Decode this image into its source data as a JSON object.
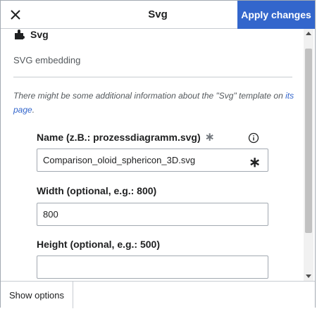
{
  "header": {
    "close_icon": "close-icon",
    "title": "Svg",
    "apply_label": "Apply changes"
  },
  "template": {
    "icon": "puzzle-icon",
    "title": "Svg",
    "description": "SVG embedding",
    "info_text": "There might be some additional information about the \"Svg\" template on ",
    "info_link": "its page",
    "info_end": "."
  },
  "params": [
    {
      "label": "Name (z.B.: prozessdiagramm.svg)",
      "required_mark": "∗",
      "value": "Comparison_oloid_sphericon_3D.svg",
      "input_mark": "∗"
    },
    {
      "label": "Width (optional, e.g.: 800)",
      "value": "800"
    },
    {
      "label": "Height (optional, e.g.: 500)",
      "value": ""
    }
  ],
  "footer": {
    "show_options_label": "Show options"
  },
  "colors": {
    "accent": "#3366cc",
    "border": "#c8ccd1",
    "text": "#202122",
    "muted": "#54595d"
  }
}
